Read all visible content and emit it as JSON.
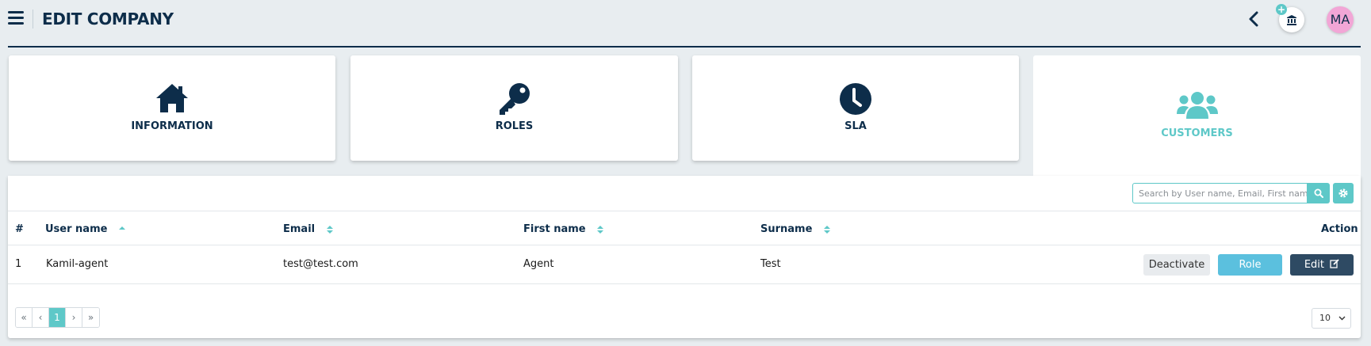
{
  "header": {
    "title": "EDIT COMPANY",
    "plus_badge": "+",
    "avatar_initials": "MA"
  },
  "tabs": [
    {
      "label": "INFORMATION",
      "icon": "home-icon"
    },
    {
      "label": "ROLES",
      "icon": "key-icon"
    },
    {
      "label": "SLA",
      "icon": "clock-icon"
    },
    {
      "label": "CUSTOMERS",
      "icon": "users-icon",
      "active": true
    }
  ],
  "toolbar": {
    "search_placeholder": "Search by User name, Email, First name"
  },
  "table": {
    "columns": [
      "#",
      "User name",
      "Email",
      "First name",
      "Surname",
      "Action"
    ],
    "rows": [
      {
        "index": "1",
        "username": "Kamil-agent",
        "email": "test@test.com",
        "first_name": "Agent",
        "surname": "Test",
        "actions": {
          "deactivate": "Deactivate",
          "role": "Role",
          "edit": "Edit"
        }
      }
    ]
  },
  "pagination": {
    "first": "«",
    "prev": "‹",
    "current": "1",
    "next": "›",
    "last": "»",
    "page_size": "10"
  },
  "colors": {
    "primary": "#0d2d4a",
    "accent": "#5ec8c8",
    "role_button": "#5bc0de",
    "edit_button": "#2e4a63",
    "avatar": "#f2a6d6"
  }
}
